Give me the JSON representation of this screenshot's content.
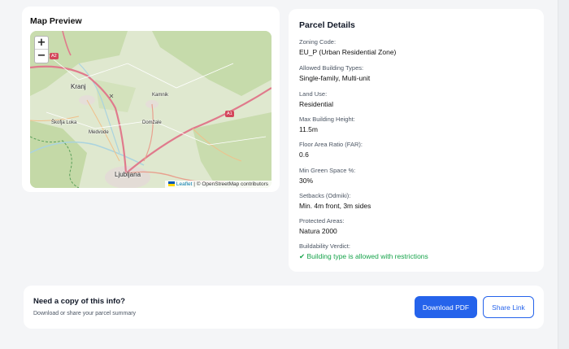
{
  "map_preview": {
    "title": "Map Preview",
    "zoom_in": "+",
    "zoom_out": "−",
    "attribution": {
      "leaflet": "Leaflet",
      "separator": " | © ",
      "osm": "OpenStreetMap contributors"
    },
    "labels": {
      "kranj": "Kranj",
      "skofja_loka": "Škofja Loka",
      "medvode": "Medvode",
      "kamnik": "Kamnik",
      "domzale": "Domžale",
      "ljubljana": "Ljubljana"
    },
    "road_shields": {
      "a2": "A2",
      "a1": "A1"
    },
    "colors": {
      "land": "#dfe8cf",
      "forest": "#c6dbab",
      "road": "#e07a8c",
      "water": "#aad3df",
      "border": "#5aa05a"
    }
  },
  "parcel_details": {
    "title": "Parcel Details",
    "fields": [
      {
        "label": "Zoning Code:",
        "value": "EU_P (Urban Residential Zone)"
      },
      {
        "label": "Allowed Building Types:",
        "value": "Single-family, Multi-unit"
      },
      {
        "label": "Land Use:",
        "value": "Residential"
      },
      {
        "label": "Max Building Height:",
        "value": "11.5m"
      },
      {
        "label": "Floor Area Ratio (FAR):",
        "value": "0.6"
      },
      {
        "label": "Min Green Space %:",
        "value": "30%"
      },
      {
        "label": "Setbacks (Odmiki):",
        "value": "Min. 4m front, 3m sides"
      },
      {
        "label": "Protected Areas:",
        "value": "Natura 2000"
      },
      {
        "label": "Buildability Verdict:",
        "value": "✔ Building type is allowed with restrictions"
      }
    ],
    "verdict_color": "#16a34a"
  },
  "copy_section": {
    "title": "Need a copy of this info?",
    "subtitle": "Download or share your parcel summary",
    "download_label": "Download PDF",
    "share_label": "Share Link",
    "accent": "#2563eb"
  }
}
